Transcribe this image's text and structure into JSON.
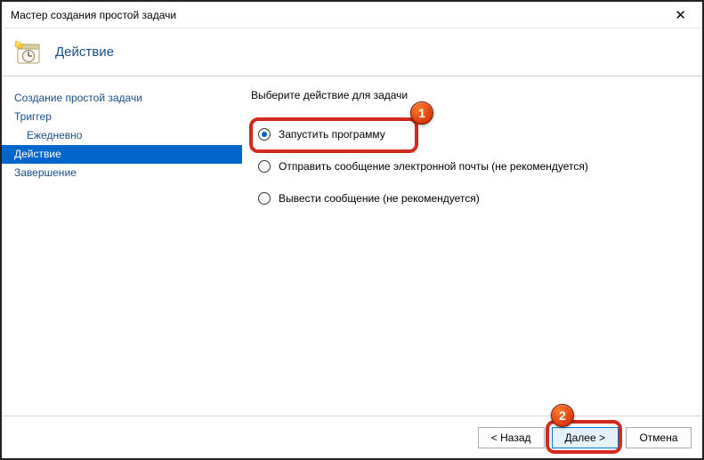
{
  "window": {
    "title": "Мастер создания простой задачи"
  },
  "header": {
    "title": "Действие"
  },
  "nav": {
    "items": [
      {
        "label": "Создание простой задачи",
        "indent": false,
        "selected": false
      },
      {
        "label": "Триггер",
        "indent": false,
        "selected": false
      },
      {
        "label": "Ежедневно",
        "indent": true,
        "selected": false
      },
      {
        "label": "Действие",
        "indent": false,
        "selected": true
      },
      {
        "label": "Завершение",
        "indent": false,
        "selected": false
      }
    ]
  },
  "content": {
    "heading": "Выберите действие для задачи",
    "options": [
      {
        "label": "Запустить программу",
        "checked": true
      },
      {
        "label": "Отправить сообщение электронной почты (не рекомендуется)",
        "checked": false
      },
      {
        "label": "Вывести сообщение (не рекомендуется)",
        "checked": false
      }
    ]
  },
  "footer": {
    "back": "< Назад",
    "next": "Далее >",
    "cancel": "Отмена"
  },
  "annotations": {
    "badge1": "1",
    "badge2": "2"
  }
}
